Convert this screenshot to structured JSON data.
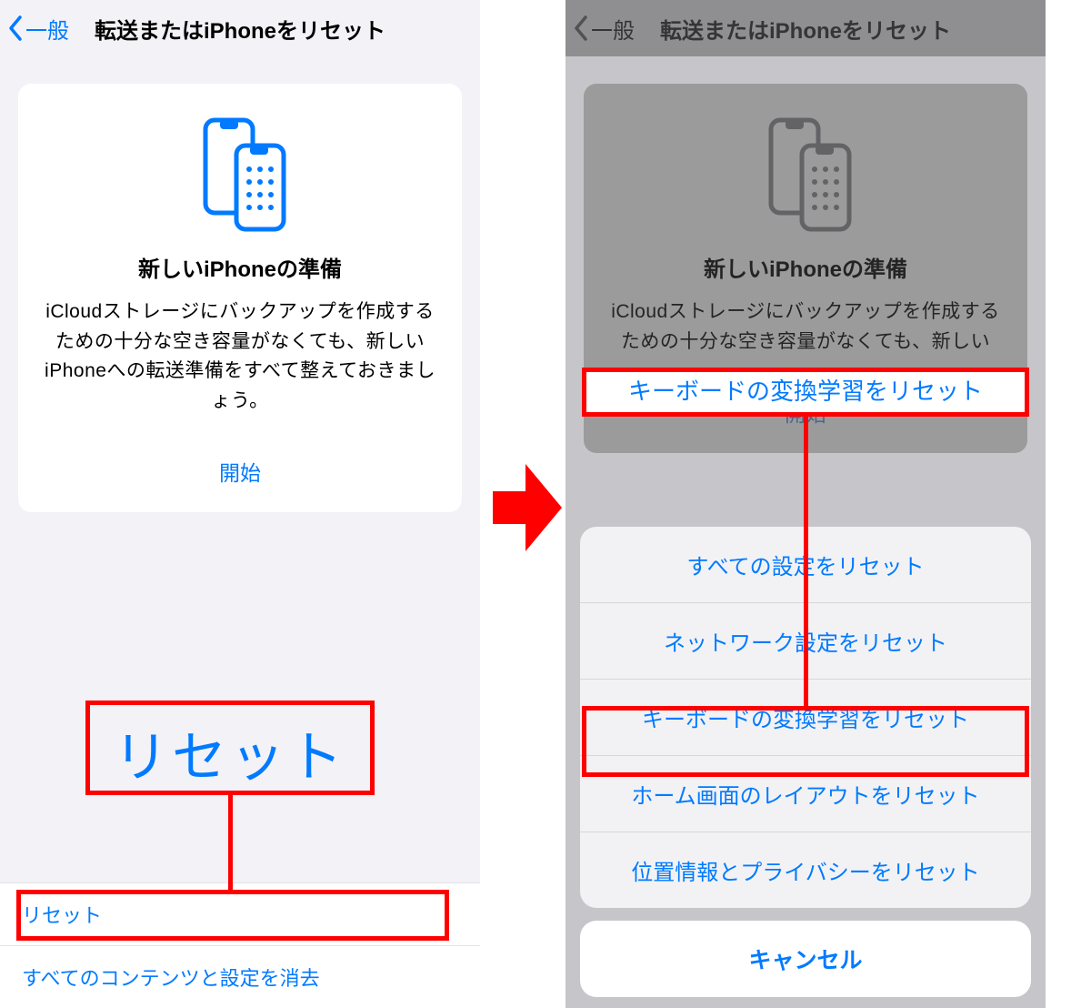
{
  "left": {
    "back_label": "一般",
    "title": "転送またはiPhoneをリセット",
    "card": {
      "title": "新しいiPhoneの準備",
      "desc": "iCloudストレージにバックアップを作成するための十分な空き容量がなくても、新しいiPhoneへの転送準備をすべて整えておきましょう。",
      "start": "開始"
    },
    "list": {
      "reset": "リセット",
      "erase": "すべてのコンテンツと設定を消去"
    },
    "annotation_big": "リセット"
  },
  "right": {
    "back_label": "一般",
    "title": "転送またはiPhoneをリセット",
    "card": {
      "title": "新しいiPhoneの準備",
      "desc_partial": "iCloudストレージにバックアップを作成するための十分な空き容量がなくても、新しい",
      "start": "開始"
    },
    "sheet": {
      "items": [
        "すべての設定をリセット",
        "ネットワーク設定をリセット",
        "キーボードの変換学習をリセット",
        "ホーム画面のレイアウトをリセット",
        "位置情報とプライバシーをリセット"
      ],
      "cancel": "キャンセル"
    },
    "annotation_label": "キーボードの変換学習をリセット"
  },
  "colors": {
    "accent": "#007aff",
    "annotation": "#ff0000"
  }
}
